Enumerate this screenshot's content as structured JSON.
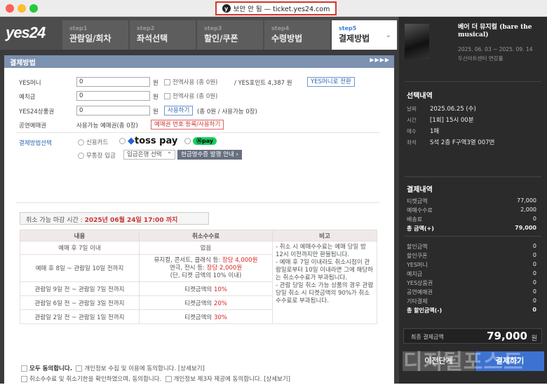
{
  "colors": {
    "accent": "#3d72d1",
    "header_bar": "#7d91b1",
    "sidebar": "#2b2b2b",
    "highlight": "#d22"
  },
  "browser": {
    "security_label": "보안 안 됨 — ticket.yes24.com"
  },
  "logo": "yes24",
  "steps": [
    {
      "num": "step1",
      "label": "관람일/회차"
    },
    {
      "num": "step2",
      "label": "좌석선택"
    },
    {
      "num": "step3",
      "label": "할인/쿠폰"
    },
    {
      "num": "step4",
      "label": "수령방법"
    },
    {
      "num": "step5",
      "label": "결제방법"
    }
  ],
  "section_title": "결제방법",
  "payment": {
    "yes_money": {
      "label": "YES머니",
      "value": "0",
      "unit": "원",
      "use_all": "전액사용 (총 0원)",
      "points": "/ YES포인트 4,387 원",
      "convert_btn": "YES머니로 전환"
    },
    "deposit": {
      "label": "예치금",
      "value": "0",
      "unit": "원",
      "use_all": "전액사용 (총 0원)"
    },
    "gift": {
      "label": "YES24상품권",
      "value": "0",
      "unit": "원",
      "use_btn": "사용하기",
      "info": "(총 0원 / 사용가능 0장)"
    },
    "voucher": {
      "label": "공연예매권",
      "info": "사용가능 예매권(총 0장)",
      "register_btn": "예매권 번호 등록/사용하기"
    },
    "method": {
      "label": "결제방법선택",
      "credit": "신용카드",
      "toss": "toss pay",
      "npay": "pay",
      "bank": "무통장 입금",
      "bank_select": "입금은행 선택",
      "receipt_btn": "현금영수증 발행 안내"
    }
  },
  "cancel_deadline": {
    "label": "취소 가능 마감 시간 :",
    "value": "2025년 06월 24일 17:00 까지"
  },
  "fee_table": {
    "headers": [
      "내용",
      "취소수수료",
      "비고"
    ],
    "rows": [
      {
        "period": "예매 후 7일 이내",
        "fee": "없음"
      },
      {
        "period": "예매 후 8일 ~ 관람일 10일 전까지",
        "fee_l1a": "뮤지컬, 콘서트, 클래식 등:",
        "fee_l1b": "장당 4,000원",
        "fee_l2a": "연극, 전시 등:",
        "fee_l2b": "장당 2,000원",
        "fee_l3": "(단, 티켓 금액의 10% 이내)"
      },
      {
        "period": "관람일 9일 전 ~ 관람일 7일 전까지",
        "fee_a": "티켓금액의",
        "fee_b": "10%"
      },
      {
        "period": "관람일 6일 전 ~ 관람일 3일 전까지",
        "fee_a": "티켓금액의",
        "fee_b": "20%"
      },
      {
        "period": "관람일 2일 전 ~ 관람일 1일 전까지",
        "fee_a": "티켓금액의",
        "fee_b": "30%"
      }
    ],
    "notes": [
      "- 취소 시 예매수수료는 예매 당일 밤 12시 이전까지만 환불됩니다.",
      "- 예매 후 7일 이내라도 취소시점이 관람일로부터 10일 이내라면 그에 해당하는 취소수수료가 부과됩니다.",
      "- 관람 당일 취소 가능 상품의 경우 관람 당일 취소 시 티켓금액의 90%가 취소수수료로 부과됩니다."
    ]
  },
  "agreements": {
    "all": "모두 동의합니다.",
    "privacy": "개인정보 수집 및 이용에 동의합니다.",
    "privacy_link": "[상세보기]",
    "cancel_fee": "취소수수료 및 취소기한을 확인하였으며, 동의합니다.",
    "third_party": "개인정보 제3자 제공에 동의합니다.",
    "third_link": "[상세보기]"
  },
  "sidebar": {
    "show_title": "베어 더 뮤지컬 (bare the musical)",
    "show_period": "2025. 06. 03 ~ 2025. 09. 14",
    "venue": "두산아트센터 연강홀",
    "selection_title": "선택내역",
    "selection": [
      {
        "k": "날짜",
        "v": "2025.06.25 (수)"
      },
      {
        "k": "시간",
        "v": "[1회] 15시 00분"
      },
      {
        "k": "매수",
        "v": "1매"
      },
      {
        "k": "좌석",
        "v": "S석 2층 F구역3열 007번"
      }
    ],
    "payment_title": "결제내역",
    "amounts": [
      {
        "k": "티켓금액",
        "v": "77,000"
      },
      {
        "k": "예매수수료",
        "v": "2,000"
      },
      {
        "k": "배송료",
        "v": "0"
      },
      {
        "k": "총 금액(+)",
        "v": "79,000"
      }
    ],
    "discounts": [
      {
        "k": "할인금액",
        "v": "0"
      },
      {
        "k": "할인쿠폰",
        "v": "0"
      },
      {
        "k": "YES머니",
        "v": "0"
      },
      {
        "k": "예치금",
        "v": "0"
      },
      {
        "k": "YES상품권",
        "v": "0"
      },
      {
        "k": "공연예매권",
        "v": "0"
      },
      {
        "k": "기타결제",
        "v": "0"
      },
      {
        "k": "총 할인금액(-)",
        "v": "0"
      }
    ],
    "final_label": "최종 결제금액",
    "final_value": "79,000",
    "final_unit": "원",
    "prev_btn": "이전단계",
    "pay_btn": "결제하기"
  },
  "watermark": "디지털포스트"
}
